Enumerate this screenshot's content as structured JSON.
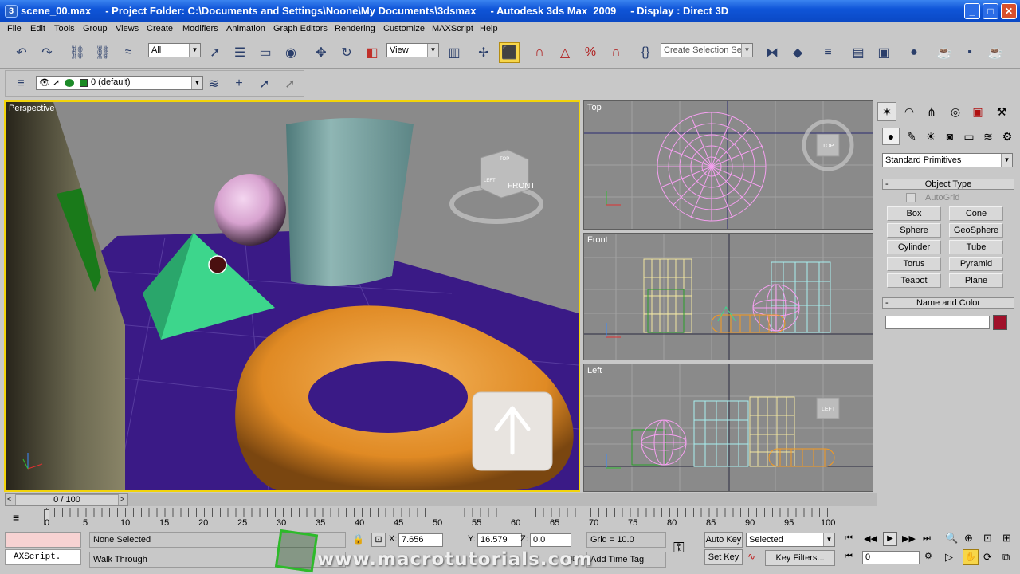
{
  "window": {
    "title": "scene_00.max     - Project Folder: C:\\Documents and Settings\\Noone\\My Documents\\3dsmax     - Autodesk 3ds Max  2009     - Display : Direct 3D"
  },
  "menu": [
    "File",
    "Edit",
    "Tools",
    "Group",
    "Views",
    "Create",
    "Modifiers",
    "Animation",
    "Graph Editors",
    "Rendering",
    "Customize",
    "MAXScript",
    "Help"
  ],
  "toolbar": {
    "selection_filter": "All",
    "reference_coord": "View",
    "selection_set_placeholder": "Create Selection Set"
  },
  "layer": {
    "current": "0 (default)"
  },
  "viewports": {
    "perspective": "Perspective",
    "top": "Top",
    "front": "Front",
    "left": "Left",
    "cube_top": "TOP",
    "cube_front": "FRONT",
    "cube_left": "LEFT",
    "cube_persp_top": "TOP",
    "cube_persp_left": "LEFT"
  },
  "command_panel": {
    "dropdown": "Standard Primitives",
    "object_type_title": "Object Type",
    "autogrid": "AutoGrid",
    "buttons": [
      "Box",
      "Cone",
      "Sphere",
      "GeoSphere",
      "Cylinder",
      "Tube",
      "Torus",
      "Pyramid",
      "Teapot",
      "Plane"
    ],
    "name_color_title": "Name and Color",
    "name_value": "",
    "object_color": "#a0102a"
  },
  "timeline": {
    "frame_display": "0 / 100",
    "ticks": [
      "0",
      "5",
      "10",
      "15",
      "20",
      "25",
      "30",
      "35",
      "40",
      "45",
      "50",
      "55",
      "60",
      "65",
      "70",
      "75",
      "80",
      "85",
      "90",
      "95",
      "100"
    ]
  },
  "status": {
    "maxscript": "AXScript.",
    "selection": "None Selected",
    "prompt": "Walk Through",
    "x_label": "X:",
    "x": "7.656",
    "y_label": "Y:",
    "y": "16.579",
    "z_label": "Z:",
    "z": "0.0",
    "grid": "Grid = 10.0",
    "add_time_tag": "Add Time Tag",
    "auto_key": "Auto Key",
    "set_key": "Set Key",
    "key_mode": "Selected",
    "key_filters": "Key Filters...",
    "current_frame": "0",
    "watermark": "www.macrotutorials.com"
  },
  "colors": {
    "accent_viewport": "#f2d40a",
    "torus": "#e8952e",
    "pyramid": "#3dd68c",
    "ground": "#3a1a86"
  }
}
